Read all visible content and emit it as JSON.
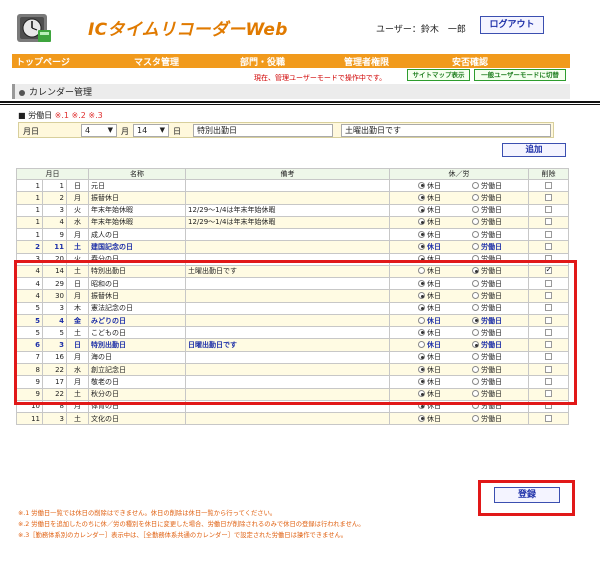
{
  "header": {
    "app_title": "ICタイムリコーダーWeb",
    "user_label": "ユーザー：鈴木　一郎",
    "logout_label": "ログアウト"
  },
  "nav": {
    "items": [
      "トップページ",
      "マスタ管理",
      "部門・役職",
      "管理者権限",
      "安否確認"
    ]
  },
  "subnav": {
    "mode_note": "現在、管理ユーザーモードで操作中です。",
    "sitemap_label": "サイトマップ表示",
    "general_mode_label": "一般ユーザーモードに切替"
  },
  "section": {
    "title": "カレンダー管理"
  },
  "form": {
    "holiday_label": "■ 労働日",
    "required_marks": "※.1 ※.2 ※.3",
    "row_label": "月日",
    "month_value": "4",
    "month_unit": "月",
    "day_value": "14",
    "day_unit": "日",
    "name_value": "特別出勤日",
    "remark_value": "土曜出勤日です",
    "add_label": "追加"
  },
  "table": {
    "headers": [
      "月日",
      "名称",
      "備考",
      "休／労",
      "削除"
    ],
    "option_holiday": "休日",
    "option_workday": "労働日",
    "rows": [
      {
        "no": "1",
        "m": "1",
        "d": "日",
        "name": "元日",
        "remark": "",
        "state": "holiday",
        "del": false,
        "hl": false
      },
      {
        "no": "1",
        "m": "2",
        "d": "月",
        "name": "振替休日",
        "remark": "",
        "state": "holiday",
        "del": false,
        "hl": false
      },
      {
        "no": "1",
        "m": "3",
        "d": "火",
        "name": "年末年始休暇",
        "remark": "12/29～1/4は年末年始休暇",
        "state": "holiday",
        "del": false,
        "hl": false
      },
      {
        "no": "1",
        "m": "4",
        "d": "水",
        "name": "年末年始休暇",
        "remark": "12/29～1/4は年末年始休暇",
        "state": "holiday",
        "del": false,
        "hl": false
      },
      {
        "no": "1",
        "m": "9",
        "d": "月",
        "name": "成人の日",
        "remark": "",
        "state": "holiday",
        "del": false,
        "hl": false
      },
      {
        "no": "2",
        "m": "11",
        "d": "土",
        "name": "建国記念の日",
        "remark": "",
        "state": "holiday",
        "del": false,
        "hl": true
      },
      {
        "no": "3",
        "m": "20",
        "d": "火",
        "name": "春分の日",
        "remark": "",
        "state": "holiday",
        "del": false,
        "hl": false
      },
      {
        "no": "4",
        "m": "14",
        "d": "土",
        "name": "特別出勤日",
        "remark": "土曜出勤日です",
        "state": "workday",
        "del": true,
        "hl": false
      },
      {
        "no": "4",
        "m": "29",
        "d": "日",
        "name": "昭和の日",
        "remark": "",
        "state": "holiday",
        "del": false,
        "hl": false
      },
      {
        "no": "4",
        "m": "30",
        "d": "月",
        "name": "振替休日",
        "remark": "",
        "state": "holiday",
        "del": false,
        "hl": false
      },
      {
        "no": "5",
        "m": "3",
        "d": "木",
        "name": "憲法記念の日",
        "remark": "",
        "state": "holiday",
        "del": false,
        "hl": false
      },
      {
        "no": "5",
        "m": "4",
        "d": "金",
        "name": "みどりの日",
        "remark": "",
        "state": "workday",
        "del": false,
        "hl": true
      },
      {
        "no": "5",
        "m": "5",
        "d": "土",
        "name": "こどもの日",
        "remark": "",
        "state": "holiday",
        "del": false,
        "hl": false
      },
      {
        "no": "6",
        "m": "3",
        "d": "日",
        "name": "特別出勤日",
        "remark": "日曜出勤日です",
        "state": "workday",
        "del": false,
        "hl": true
      },
      {
        "no": "7",
        "m": "16",
        "d": "月",
        "name": "海の日",
        "remark": "",
        "state": "holiday",
        "del": false,
        "hl": false
      },
      {
        "no": "8",
        "m": "22",
        "d": "水",
        "name": "創立記念日",
        "remark": "",
        "state": "holiday",
        "del": false,
        "hl": false
      },
      {
        "no": "9",
        "m": "17",
        "d": "月",
        "name": "敬老の日",
        "remark": "",
        "state": "holiday",
        "del": false,
        "hl": false
      },
      {
        "no": "9",
        "m": "22",
        "d": "土",
        "name": "秋分の日",
        "remark": "",
        "state": "holiday",
        "del": false,
        "hl": false
      },
      {
        "no": "10",
        "m": "8",
        "d": "月",
        "name": "体育の日",
        "remark": "",
        "state": "holiday",
        "del": false,
        "hl": false
      },
      {
        "no": "11",
        "m": "3",
        "d": "土",
        "name": "文化の日",
        "remark": "",
        "state": "holiday",
        "del": false,
        "hl": false
      }
    ]
  },
  "register_label": "登録",
  "notes": [
    "※.1 労働日一覧では休日の削除はできません。休日の削除は休日一覧から行ってください。",
    "※.2 労働日を追加したのちに休／労の種別を休日に変更した場合、労働日が削除されるのみで休日の登録は行われません。",
    "※.3［勤務体系別のカレンダー］表示中は、［全勤務体系共通のカレンダー］で設定された労働日は操作できません。"
  ]
}
